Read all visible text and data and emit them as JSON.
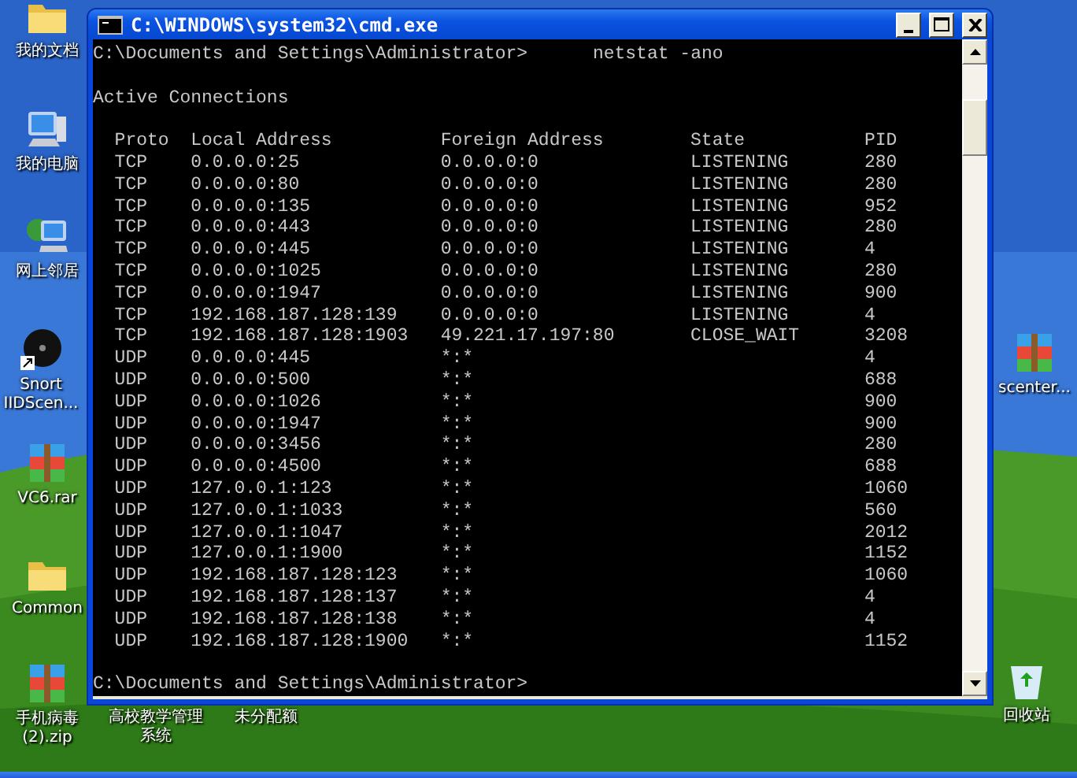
{
  "desktop": {
    "icons": [
      {
        "kind": "folder",
        "label": "我的文档"
      },
      {
        "kind": "computer",
        "label": "我的电脑"
      },
      {
        "kind": "network",
        "label": "网上邻居"
      },
      {
        "kind": "snort",
        "label": "Snort IIDScen..."
      },
      {
        "kind": "archive",
        "label": "VC6.rar"
      },
      {
        "kind": "folder",
        "label": "Common"
      },
      {
        "kind": "archive",
        "label": "手机病毒(2).zip"
      },
      {
        "kind": "hidden",
        "label": "高校教学管理系统"
      },
      {
        "kind": "hidden",
        "label": "未分配额"
      },
      {
        "kind": "archive",
        "label": "scenter..."
      },
      {
        "kind": "recycle",
        "label": "回收站"
      }
    ]
  },
  "window": {
    "title": "C:\\WINDOWS\\system32\\cmd.exe",
    "console": {
      "prompt": "C:\\Documents and Settings\\Administrator>",
      "command": "netstat -ano",
      "heading": "Active Connections",
      "columns": [
        "Proto",
        "Local Address",
        "Foreign Address",
        "State",
        "PID"
      ],
      "rows": [
        {
          "proto": "TCP",
          "local": "0.0.0.0:25",
          "foreign": "0.0.0.0:0",
          "state": "LISTENING",
          "pid": "280"
        },
        {
          "proto": "TCP",
          "local": "0.0.0.0:80",
          "foreign": "0.0.0.0:0",
          "state": "LISTENING",
          "pid": "280"
        },
        {
          "proto": "TCP",
          "local": "0.0.0.0:135",
          "foreign": "0.0.0.0:0",
          "state": "LISTENING",
          "pid": "952"
        },
        {
          "proto": "TCP",
          "local": "0.0.0.0:443",
          "foreign": "0.0.0.0:0",
          "state": "LISTENING",
          "pid": "280"
        },
        {
          "proto": "TCP",
          "local": "0.0.0.0:445",
          "foreign": "0.0.0.0:0",
          "state": "LISTENING",
          "pid": "4"
        },
        {
          "proto": "TCP",
          "local": "0.0.0.0:1025",
          "foreign": "0.0.0.0:0",
          "state": "LISTENING",
          "pid": "280"
        },
        {
          "proto": "TCP",
          "local": "0.0.0.0:1947",
          "foreign": "0.0.0.0:0",
          "state": "LISTENING",
          "pid": "900"
        },
        {
          "proto": "TCP",
          "local": "192.168.187.128:139",
          "foreign": "0.0.0.0:0",
          "state": "LISTENING",
          "pid": "4"
        },
        {
          "proto": "TCP",
          "local": "192.168.187.128:1903",
          "foreign": "49.221.17.197:80",
          "state": "CLOSE_WAIT",
          "pid": "3208"
        },
        {
          "proto": "UDP",
          "local": "0.0.0.0:445",
          "foreign": "*:*",
          "pid": "4"
        },
        {
          "proto": "UDP",
          "local": "0.0.0.0:500",
          "foreign": "*:*",
          "pid": "688"
        },
        {
          "proto": "UDP",
          "local": "0.0.0.0:1026",
          "foreign": "*:*",
          "pid": "900"
        },
        {
          "proto": "UDP",
          "local": "0.0.0.0:1947",
          "foreign": "*:*",
          "pid": "900"
        },
        {
          "proto": "UDP",
          "local": "0.0.0.0:3456",
          "foreign": "*:*",
          "pid": "280"
        },
        {
          "proto": "UDP",
          "local": "0.0.0.0:4500",
          "foreign": "*:*",
          "pid": "688"
        },
        {
          "proto": "UDP",
          "local": "127.0.0.1:123",
          "foreign": "*:*",
          "pid": "1060"
        },
        {
          "proto": "UDP",
          "local": "127.0.0.1:1033",
          "foreign": "*:*",
          "pid": "560"
        },
        {
          "proto": "UDP",
          "local": "127.0.0.1:1047",
          "foreign": "*:*",
          "pid": "2012"
        },
        {
          "proto": "UDP",
          "local": "127.0.0.1:1900",
          "foreign": "*:*",
          "pid": "1152"
        },
        {
          "proto": "UDP",
          "local": "192.168.187.128:123",
          "foreign": "*:*",
          "pid": "1060"
        },
        {
          "proto": "UDP",
          "local": "192.168.187.128:137",
          "foreign": "*:*",
          "pid": "4"
        },
        {
          "proto": "UDP",
          "local": "192.168.187.128:138",
          "foreign": "*:*",
          "pid": "4"
        },
        {
          "proto": "UDP",
          "local": "192.168.187.128:1900",
          "foreign": "*:*",
          "pid": "1152"
        }
      ],
      "final_prompt": "C:\\Documents and Settings\\Administrator>"
    }
  }
}
